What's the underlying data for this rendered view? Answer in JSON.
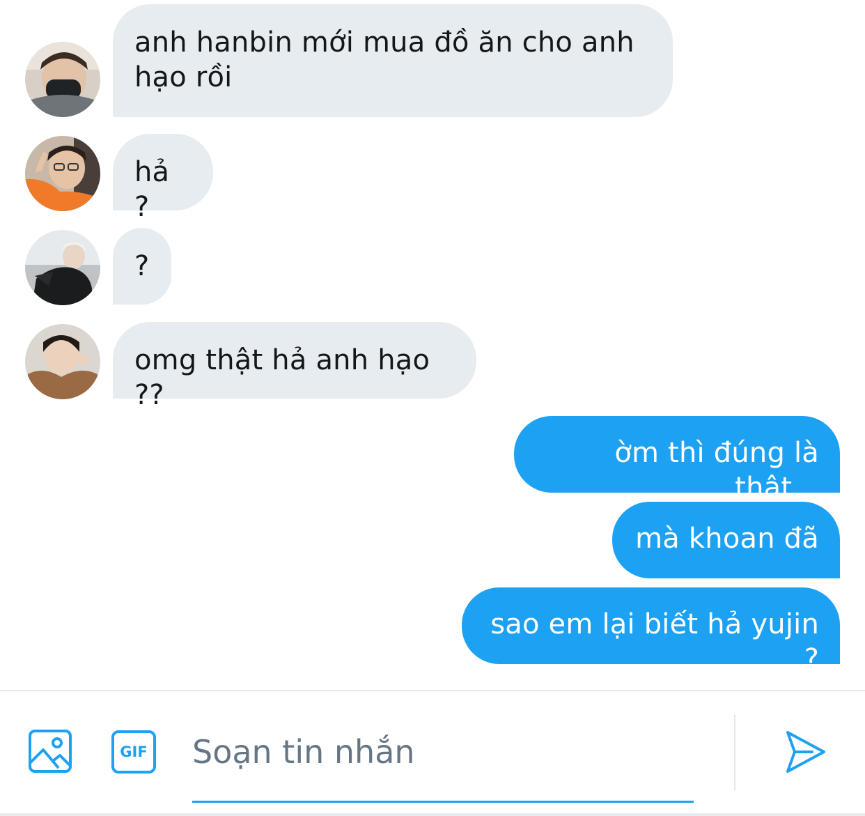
{
  "messages": [
    {
      "direction": "incoming",
      "avatar": "avatar-person-face-mask",
      "lines": [
        "anh hanbin mới mua đồ ăn cho anh",
        "hạo rồi"
      ]
    },
    {
      "direction": "incoming",
      "avatar": "avatar-person-orange-shirt",
      "lines": [
        "hả ?"
      ]
    },
    {
      "direction": "incoming",
      "avatar": "avatar-person-dark-jacket",
      "lines": [
        "?"
      ]
    },
    {
      "direction": "incoming",
      "avatar": "avatar-person-brown-hoodie",
      "lines": [
        "omg thật hả anh hạo ??"
      ]
    },
    {
      "direction": "outgoing",
      "lines": [
        "ờm thì đúng là thật..."
      ]
    },
    {
      "direction": "outgoing",
      "lines": [
        "mà khoan đã"
      ]
    },
    {
      "direction": "outgoing",
      "lines": [
        "sao em lại biết hả yujin ?"
      ]
    }
  ],
  "composer": {
    "placeholder": "Soạn tin nhắn",
    "value": "",
    "gif_label": "GIF",
    "icons": {
      "media": "image-icon",
      "gif": "gif-icon",
      "send": "send-icon"
    }
  },
  "colors": {
    "incoming_bubble": "#e6ecf0",
    "outgoing_bubble": "#1da1f2",
    "accent": "#1da1f2",
    "text": "#14171a",
    "placeholder": "#657786"
  }
}
